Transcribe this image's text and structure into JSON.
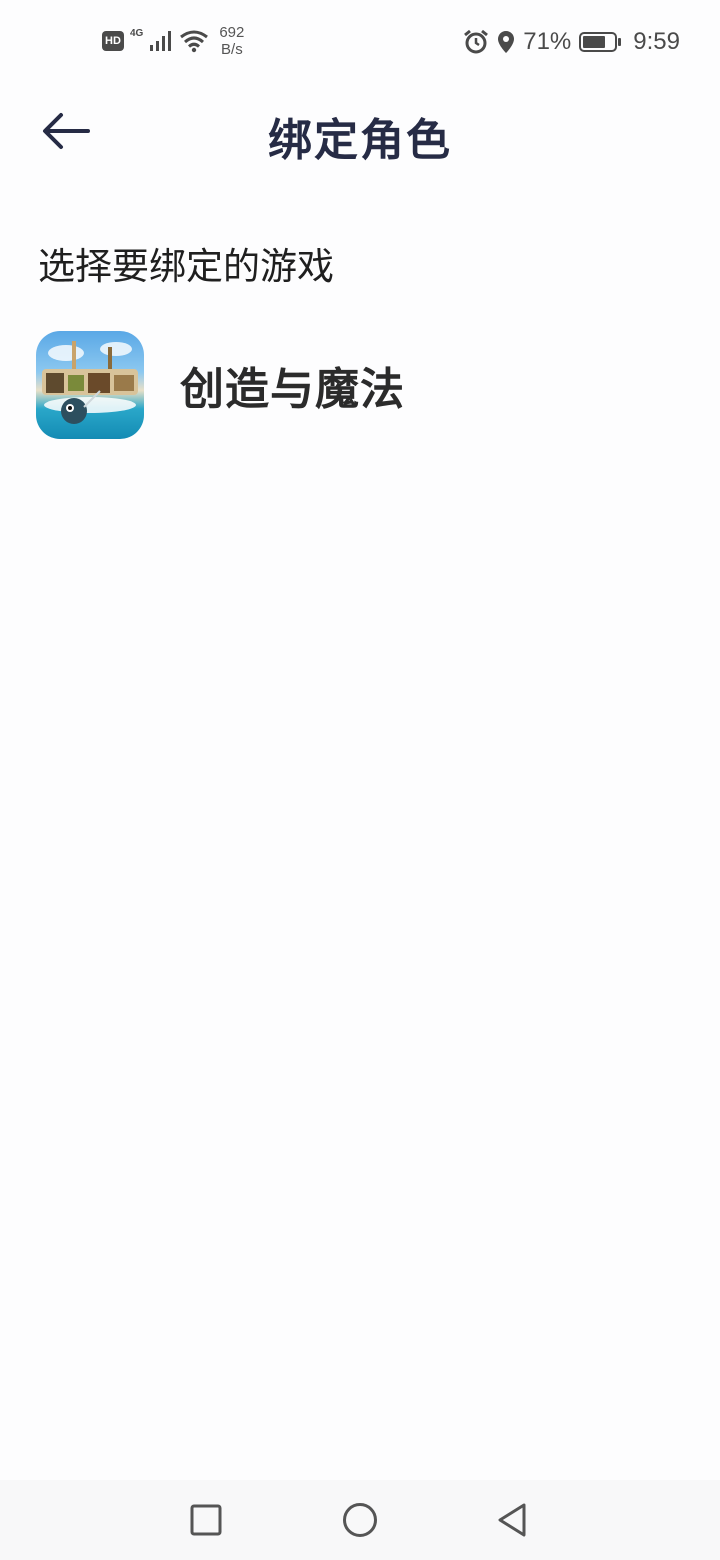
{
  "status_bar": {
    "hd": "HD",
    "network_type": "4G",
    "speed_value": "692",
    "speed_unit": "B/s",
    "battery_percent": "71%",
    "battery_level": 0.71,
    "time": "9:59"
  },
  "header": {
    "title": "绑定角色"
  },
  "section_label": "选择要绑定的游戏",
  "games": [
    {
      "name": "创造与魔法"
    }
  ],
  "nav_bar": {
    "recents": "square-icon",
    "home": "circle-icon",
    "back": "triangle-back-icon"
  }
}
